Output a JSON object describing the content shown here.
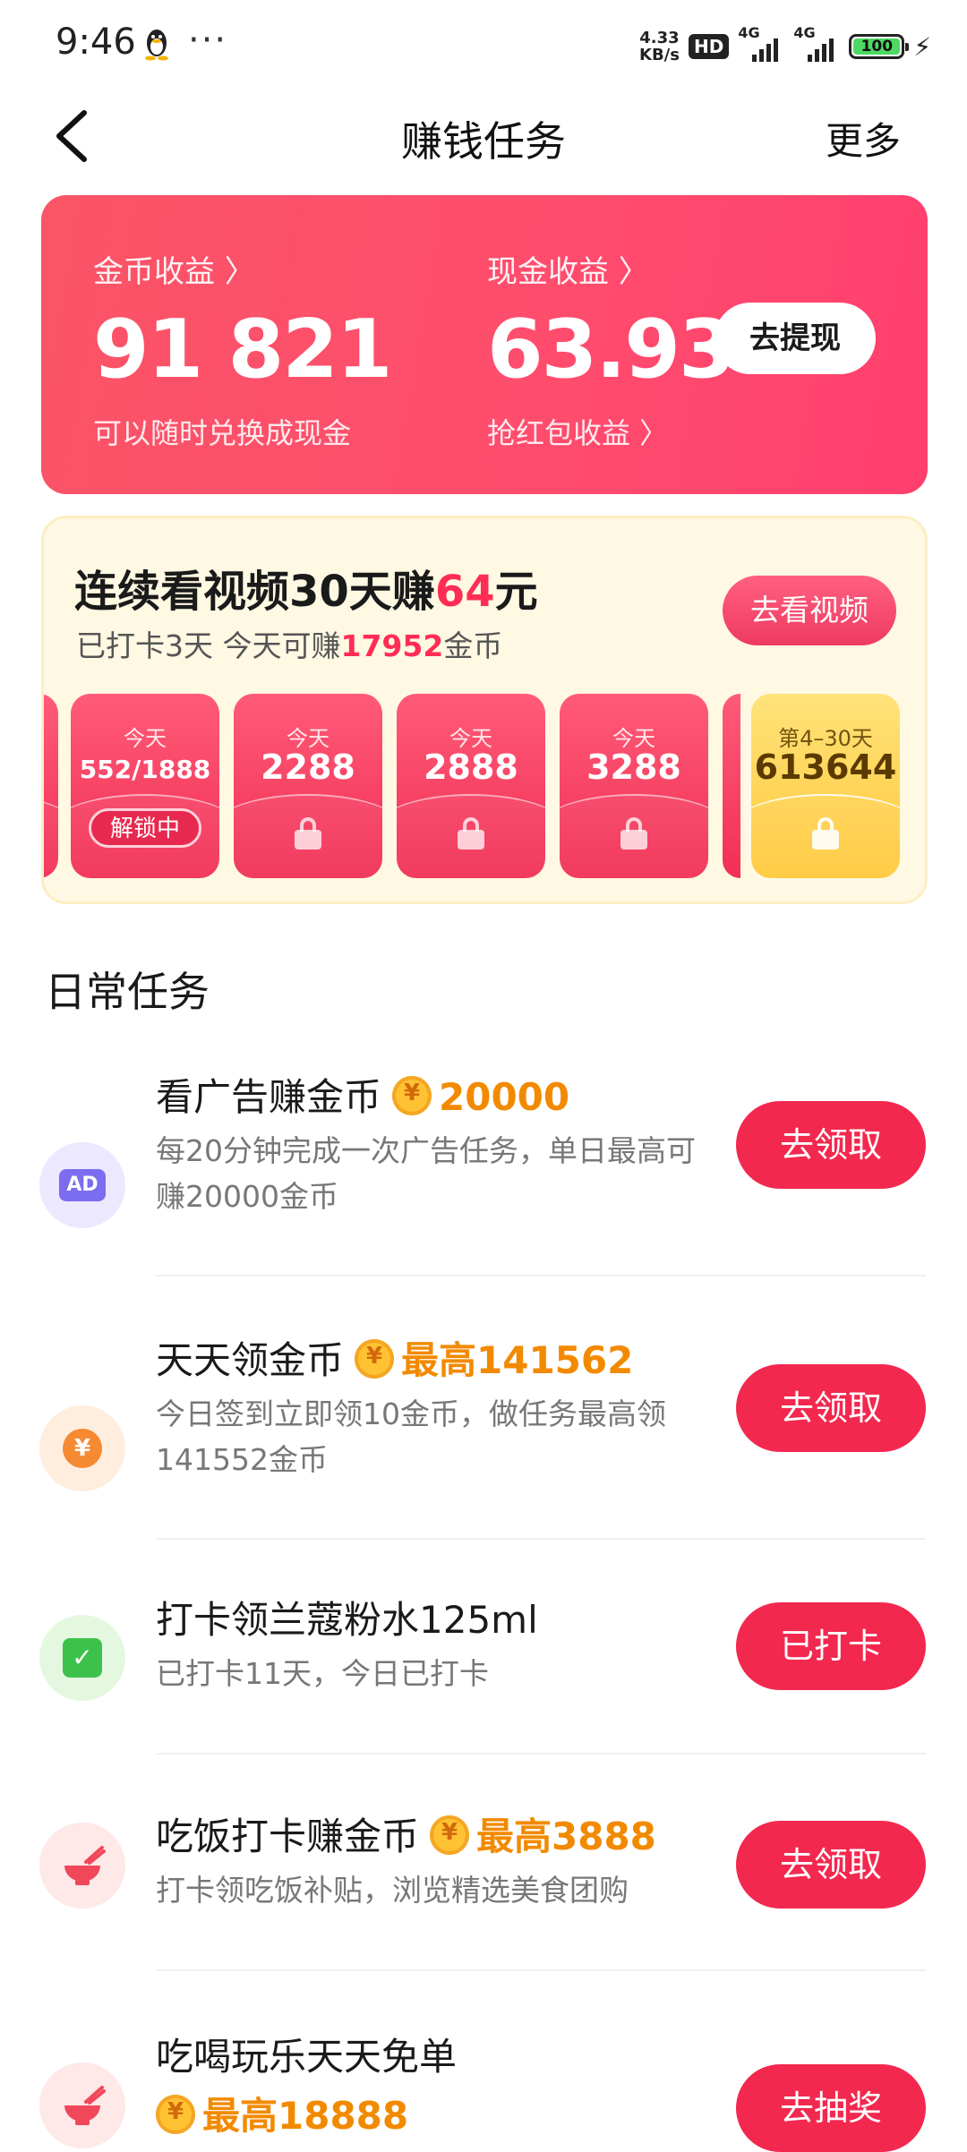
{
  "status_bar": {
    "time": "9:46",
    "dots": "···",
    "net_speed_top": "4.33",
    "net_speed_bottom": "KB/s",
    "hd": "HD",
    "sig1": "4G",
    "sig2": "4G",
    "battery": "100"
  },
  "nav": {
    "title": "赚钱任务",
    "more": "更多"
  },
  "earnings": {
    "coin_label": "金币收益 〉",
    "coin_value": "91 821",
    "coin_sub": "可以随时兑换成现金",
    "cash_label": "现金收益 〉",
    "cash_value": "63.93",
    "cash_sub": "抢红包收益 〉",
    "withdraw": "去提现"
  },
  "checkin": {
    "title_pre": "连续看视频30天赚",
    "title_amount": "64",
    "title_post": "元",
    "sub_pre": "已打卡3天 今天可赚",
    "sub_amount": "17952",
    "sub_post": "金币",
    "button": "去看视频",
    "envelopes": [
      {
        "label": "今天",
        "value": "552/1888",
        "badge": "解锁中"
      },
      {
        "label": "今天",
        "value": "2288"
      },
      {
        "label": "今天",
        "value": "2888"
      },
      {
        "label": "今天",
        "value": "3288"
      },
      {
        "label": "第4–30天",
        "value": "613644"
      }
    ]
  },
  "daily": {
    "title": "日常任务",
    "tasks": [
      {
        "name": "看广告赚金币",
        "reward": "20000",
        "desc": "每20分钟完成一次广告任务，单日最高可赚20000金币",
        "button": "去领取",
        "icon": "ad-icon",
        "icon_text": "AD"
      },
      {
        "name": "天天领金币",
        "reward": "最高141562",
        "desc": "今日签到立即领10金币，做任务最高领141552金币",
        "button": "去领取",
        "icon": "yuan-coin-icon",
        "icon_text": "¥"
      },
      {
        "name": "打卡领兰蔻粉水125ml",
        "reward": "",
        "desc": "已打卡11天，今日已打卡",
        "button": "已打卡",
        "icon": "calendar-check-icon",
        "icon_text": "✓"
      },
      {
        "name": "吃饭打卡赚金币",
        "reward": "最高3888",
        "desc": "打卡领吃饭补贴，浏览精选美食团购",
        "button": "去领取",
        "icon": "rice-bowl-icon"
      },
      {
        "name": "吃喝玩乐天天免单",
        "reward": "最高18888",
        "desc": "",
        "button": "去抽奖",
        "icon": "rice-bowl-icon"
      }
    ]
  },
  "colors": {
    "accent": "#f3284f",
    "reward": "#f28a00",
    "card_bg": "#fff8e3"
  }
}
